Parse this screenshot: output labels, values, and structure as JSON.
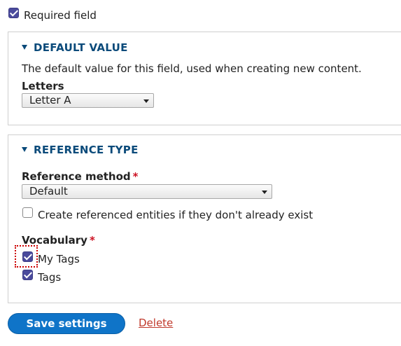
{
  "required_field": {
    "label": "Required field",
    "checked": true
  },
  "default_value": {
    "legend": "DEFAULT VALUE",
    "description": "The default value for this field, used when creating new content.",
    "letters_label": "Letters",
    "letters_value": "Letter A"
  },
  "reference_type": {
    "legend": "REFERENCE TYPE",
    "method_label": "Reference method",
    "method_required": "*",
    "method_value": "Default",
    "create_label": "Create referenced entities if they don't already exist",
    "create_checked": false,
    "vocabulary_label": "Vocabulary",
    "vocabulary_required": "*",
    "vocabularies": [
      {
        "label": "My Tags",
        "checked": true
      },
      {
        "label": "Tags",
        "checked": true
      }
    ]
  },
  "actions": {
    "save_label": "Save settings",
    "delete_label": "Delete"
  },
  "colors": {
    "primary_button": "#0f74c8",
    "legend_text": "#0a4a7a",
    "delete_link": "#c0392b",
    "required_mark": "#cc1122",
    "checkbox_checked": "#4a4a9c"
  }
}
